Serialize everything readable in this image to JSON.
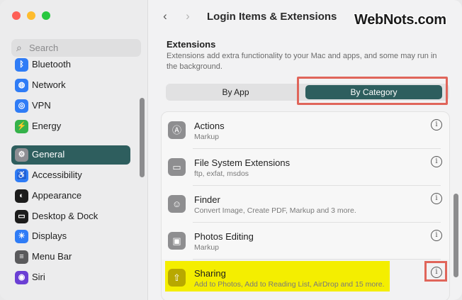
{
  "window": {
    "title": "Login Items & Extensions",
    "watermark": "WebNots.com",
    "back_icon": "‹",
    "forward_icon": "›"
  },
  "sidebar": {
    "search_placeholder": "Search",
    "items": [
      {
        "label": "Bluetooth",
        "icon": "bluetooth-icon",
        "glyph": "ᛒ",
        "color": "#2f7cf6"
      },
      {
        "label": "Network",
        "icon": "globe-icon",
        "glyph": "◍",
        "color": "#2f7cf6"
      },
      {
        "label": "VPN",
        "icon": "vpn-icon",
        "glyph": "◎",
        "color": "#2f7cf6"
      },
      {
        "label": "Energy",
        "icon": "energy-icon",
        "glyph": "⚡",
        "color": "#35b24a"
      },
      {
        "label": "General",
        "icon": "gear-icon",
        "glyph": "⚙",
        "color": "#8e8e93",
        "active": true
      },
      {
        "label": "Accessibility",
        "icon": "accessibility-icon",
        "glyph": "♿",
        "color": "#2f7cf6"
      },
      {
        "label": "Appearance",
        "icon": "appearance-icon",
        "glyph": "◐",
        "color": "#1c1c1c"
      },
      {
        "label": "Desktop & Dock",
        "icon": "dock-icon",
        "glyph": "▭",
        "color": "#1c1c1c"
      },
      {
        "label": "Displays",
        "icon": "displays-icon",
        "glyph": "☀",
        "color": "#2f7cf6"
      },
      {
        "label": "Menu Bar",
        "icon": "menu-bar-icon",
        "glyph": "≡",
        "color": "#5a5a5c"
      },
      {
        "label": "Siri",
        "icon": "siri-icon",
        "glyph": "◉",
        "color": "#6b3fd4"
      }
    ]
  },
  "extensions": {
    "title": "Extensions",
    "description": "Extensions add extra functionality to your Mac and apps, and some may run in the background.",
    "segment": {
      "by_app": "By App",
      "by_category": "By Category",
      "selected": "By Category"
    },
    "rows": [
      {
        "name": "Actions",
        "detail": "Markup",
        "icon": "actions-icon",
        "glyph": "Ⓐ"
      },
      {
        "name": "File System Extensions",
        "detail": "ftp, exfat, msdos",
        "icon": "drive-icon",
        "glyph": "▭"
      },
      {
        "name": "Finder",
        "detail": "Convert Image, Create PDF, Markup and 3 more.",
        "icon": "finder-icon",
        "glyph": "☺"
      },
      {
        "name": "Photos Editing",
        "detail": "Markup",
        "icon": "photos-icon",
        "glyph": "▣"
      },
      {
        "name": "Sharing",
        "detail": "Add to Photos, Add to Reading List, AirDrop and 15 more.",
        "icon": "share-icon",
        "glyph": "⇧",
        "highlighted": true
      }
    ],
    "info_glyph": "i"
  }
}
